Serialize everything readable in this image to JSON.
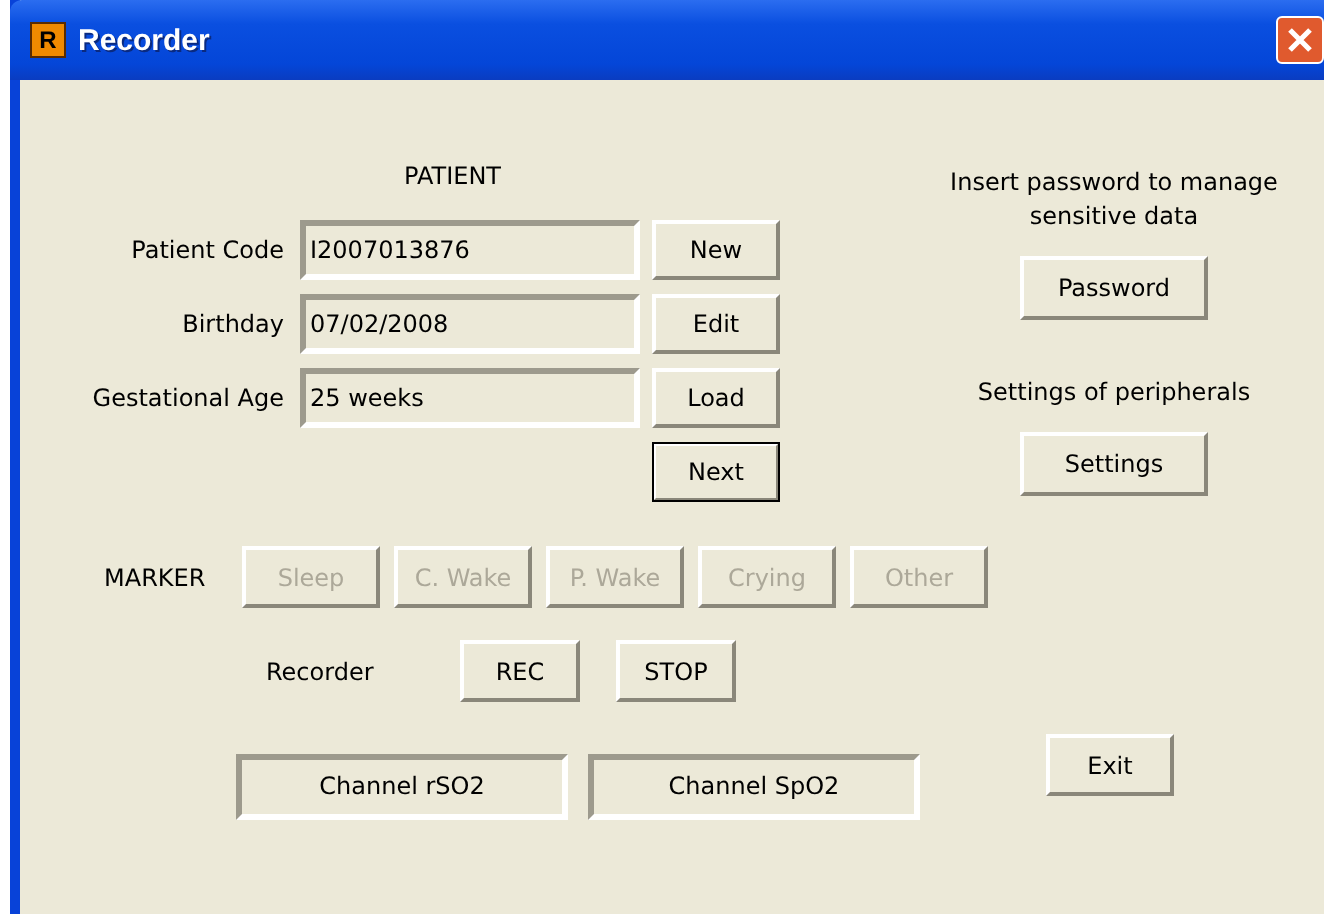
{
  "window": {
    "title": "Recorder",
    "icon_letter": "R"
  },
  "patient": {
    "heading": "PATIENT",
    "fields": [
      {
        "label": "Patient Code",
        "value": "I2007013876"
      },
      {
        "label": "Birthday",
        "value": "07/02/2008"
      },
      {
        "label": "Gestational Age",
        "value": "25 weeks"
      }
    ],
    "buttons": [
      {
        "label": "New",
        "default": false
      },
      {
        "label": "Edit",
        "default": false
      },
      {
        "label": "Load",
        "default": false
      },
      {
        "label": "Next",
        "default": true
      }
    ]
  },
  "password": {
    "text": "Insert password to manage sensitive data",
    "button": "Password"
  },
  "peripherals": {
    "text": "Settings of peripherals",
    "button": "Settings"
  },
  "marker": {
    "label": "MARKER",
    "buttons": [
      {
        "label": "Sleep",
        "disabled": true
      },
      {
        "label": "C. Wake",
        "disabled": true
      },
      {
        "label": "P. Wake",
        "disabled": true
      },
      {
        "label": "Crying",
        "disabled": true
      },
      {
        "label": "Other",
        "disabled": true
      }
    ]
  },
  "recorder": {
    "label": "Recorder",
    "buttons": [
      {
        "label": "REC",
        "disabled": false
      },
      {
        "label": "STOP",
        "disabled": false
      }
    ]
  },
  "channels": [
    "Channel rSO2",
    "Channel SpO2"
  ],
  "exit_button": "Exit"
}
